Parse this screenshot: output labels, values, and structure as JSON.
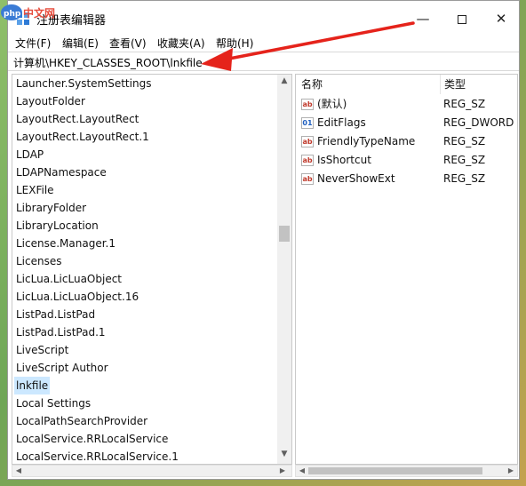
{
  "watermark": "php 中文网",
  "window": {
    "title": "注册表编辑器",
    "controls": {
      "minimize": "—",
      "close": "✕"
    }
  },
  "menu": [
    "文件(F)",
    "编辑(E)",
    "查看(V)",
    "收藏夹(A)",
    "帮助(H)"
  ],
  "address": "计算机\\HKEY_CLASSES_ROOT\\lnkfile",
  "tree": {
    "items": [
      "Launcher.SystemSettings",
      "LayoutFolder",
      "LayoutRect.LayoutRect",
      "LayoutRect.LayoutRect.1",
      "LDAP",
      "LDAPNamespace",
      "LEXFile",
      "LibraryFolder",
      "LibraryLocation",
      "License.Manager.1",
      "Licenses",
      "LicLua.LicLuaObject",
      "LicLua.LicLuaObject.16",
      "ListPad.ListPad",
      "ListPad.ListPad.1",
      "LiveScript",
      "LiveScript Author",
      "lnkfile",
      "Local Settings",
      "LocalPathSearchProvider",
      "LocalService.RRLocalService",
      "LocalService.RRLocalService.1"
    ],
    "selected": "lnkfile"
  },
  "values": {
    "columns": {
      "name": "名称",
      "type": "类型"
    },
    "rows": [
      {
        "name": "(默认)",
        "type": "REG_SZ",
        "icon": "string-value-icon",
        "glyph": "ab"
      },
      {
        "name": "EditFlags",
        "type": "REG_DWORD",
        "icon": "binary-value-icon",
        "glyph": "01"
      },
      {
        "name": "FriendlyTypeName",
        "type": "REG_SZ",
        "icon": "string-value-icon",
        "glyph": "ab"
      },
      {
        "name": "IsShortcut",
        "type": "REG_SZ",
        "icon": "string-value-icon",
        "glyph": "ab"
      },
      {
        "name": "NeverShowExt",
        "type": "REG_SZ",
        "icon": "string-value-icon",
        "glyph": "ab"
      }
    ]
  },
  "colors": {
    "selection": "#cce8ff",
    "annotation_arrow": "#e5231b",
    "badge": "#3a7bd5"
  }
}
